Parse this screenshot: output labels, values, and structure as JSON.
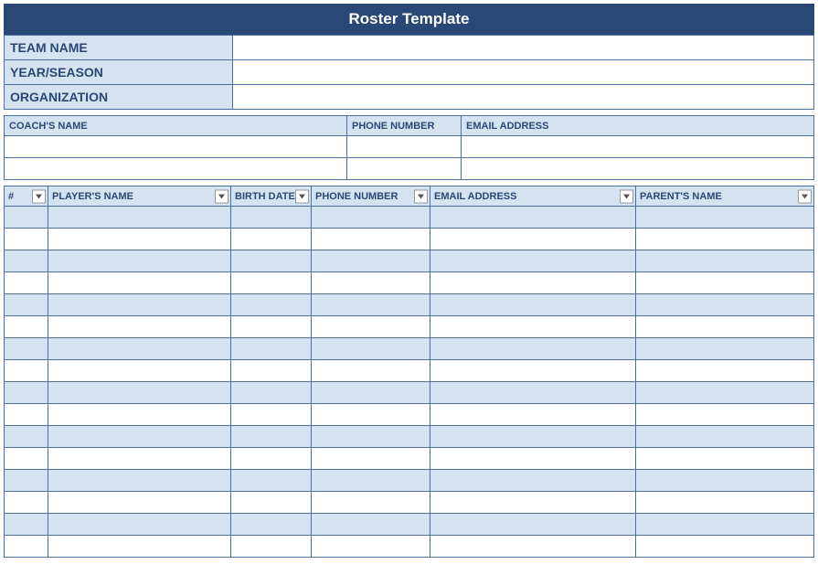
{
  "title": "Roster Template",
  "info": {
    "teamName": {
      "label": "TEAM NAME",
      "value": ""
    },
    "yearSeason": {
      "label": "YEAR/SEASON",
      "value": ""
    },
    "organization": {
      "label": "ORGANIZATION",
      "value": ""
    }
  },
  "coach": {
    "headers": {
      "name": "COACH'S NAME",
      "phone": "PHONE NUMBER",
      "email": "EMAIL ADDRESS"
    },
    "rows": [
      {
        "name": "",
        "phone": "",
        "email": ""
      },
      {
        "name": "",
        "phone": "",
        "email": ""
      }
    ]
  },
  "players": {
    "headers": {
      "num": "#",
      "name": "PLAYER'S NAME",
      "birth": "BIRTH DATE",
      "phone": "PHONE NUMBER",
      "email": "EMAIL ADDRESS",
      "parent": "PARENT'S NAME"
    },
    "rows": [
      {
        "num": "",
        "name": "",
        "birth": "",
        "phone": "",
        "email": "",
        "parent": ""
      },
      {
        "num": "",
        "name": "",
        "birth": "",
        "phone": "",
        "email": "",
        "parent": ""
      },
      {
        "num": "",
        "name": "",
        "birth": "",
        "phone": "",
        "email": "",
        "parent": ""
      },
      {
        "num": "",
        "name": "",
        "birth": "",
        "phone": "",
        "email": "",
        "parent": ""
      },
      {
        "num": "",
        "name": "",
        "birth": "",
        "phone": "",
        "email": "",
        "parent": ""
      },
      {
        "num": "",
        "name": "",
        "birth": "",
        "phone": "",
        "email": "",
        "parent": ""
      },
      {
        "num": "",
        "name": "",
        "birth": "",
        "phone": "",
        "email": "",
        "parent": ""
      },
      {
        "num": "",
        "name": "",
        "birth": "",
        "phone": "",
        "email": "",
        "parent": ""
      },
      {
        "num": "",
        "name": "",
        "birth": "",
        "phone": "",
        "email": "",
        "parent": ""
      },
      {
        "num": "",
        "name": "",
        "birth": "",
        "phone": "",
        "email": "",
        "parent": ""
      },
      {
        "num": "",
        "name": "",
        "birth": "",
        "phone": "",
        "email": "",
        "parent": ""
      },
      {
        "num": "",
        "name": "",
        "birth": "",
        "phone": "",
        "email": "",
        "parent": ""
      },
      {
        "num": "",
        "name": "",
        "birth": "",
        "phone": "",
        "email": "",
        "parent": ""
      },
      {
        "num": "",
        "name": "",
        "birth": "",
        "phone": "",
        "email": "",
        "parent": ""
      },
      {
        "num": "",
        "name": "",
        "birth": "",
        "phone": "",
        "email": "",
        "parent": ""
      },
      {
        "num": "",
        "name": "",
        "birth": "",
        "phone": "",
        "email": "",
        "parent": ""
      }
    ]
  }
}
